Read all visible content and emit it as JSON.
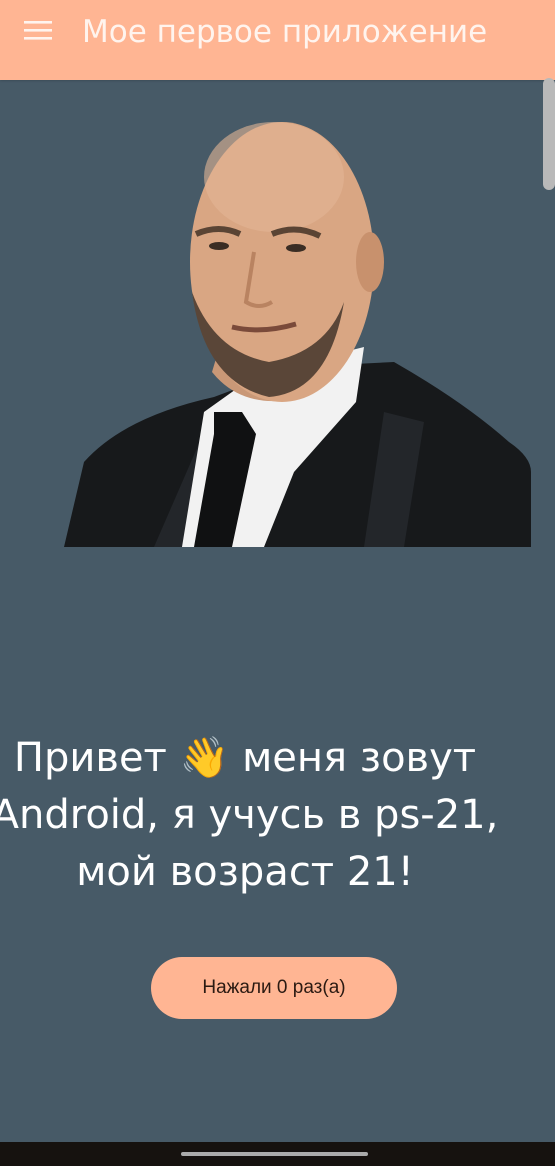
{
  "app_bar": {
    "title": "Мое первое приложение",
    "menu_icon": "hamburger-menu-icon",
    "background": "#ffb593"
  },
  "main": {
    "background": "#475a67",
    "photo": "portrait-photo",
    "greeting_text": "Привет 👋 меня зовут Android, я учусь в ps-21, мой возраст 21!",
    "button_label": "Нажали 0 раз(а)",
    "button_color": "#ffb593"
  },
  "system_nav": {
    "background": "#16120f",
    "handle_icon": "gesture-handle"
  }
}
